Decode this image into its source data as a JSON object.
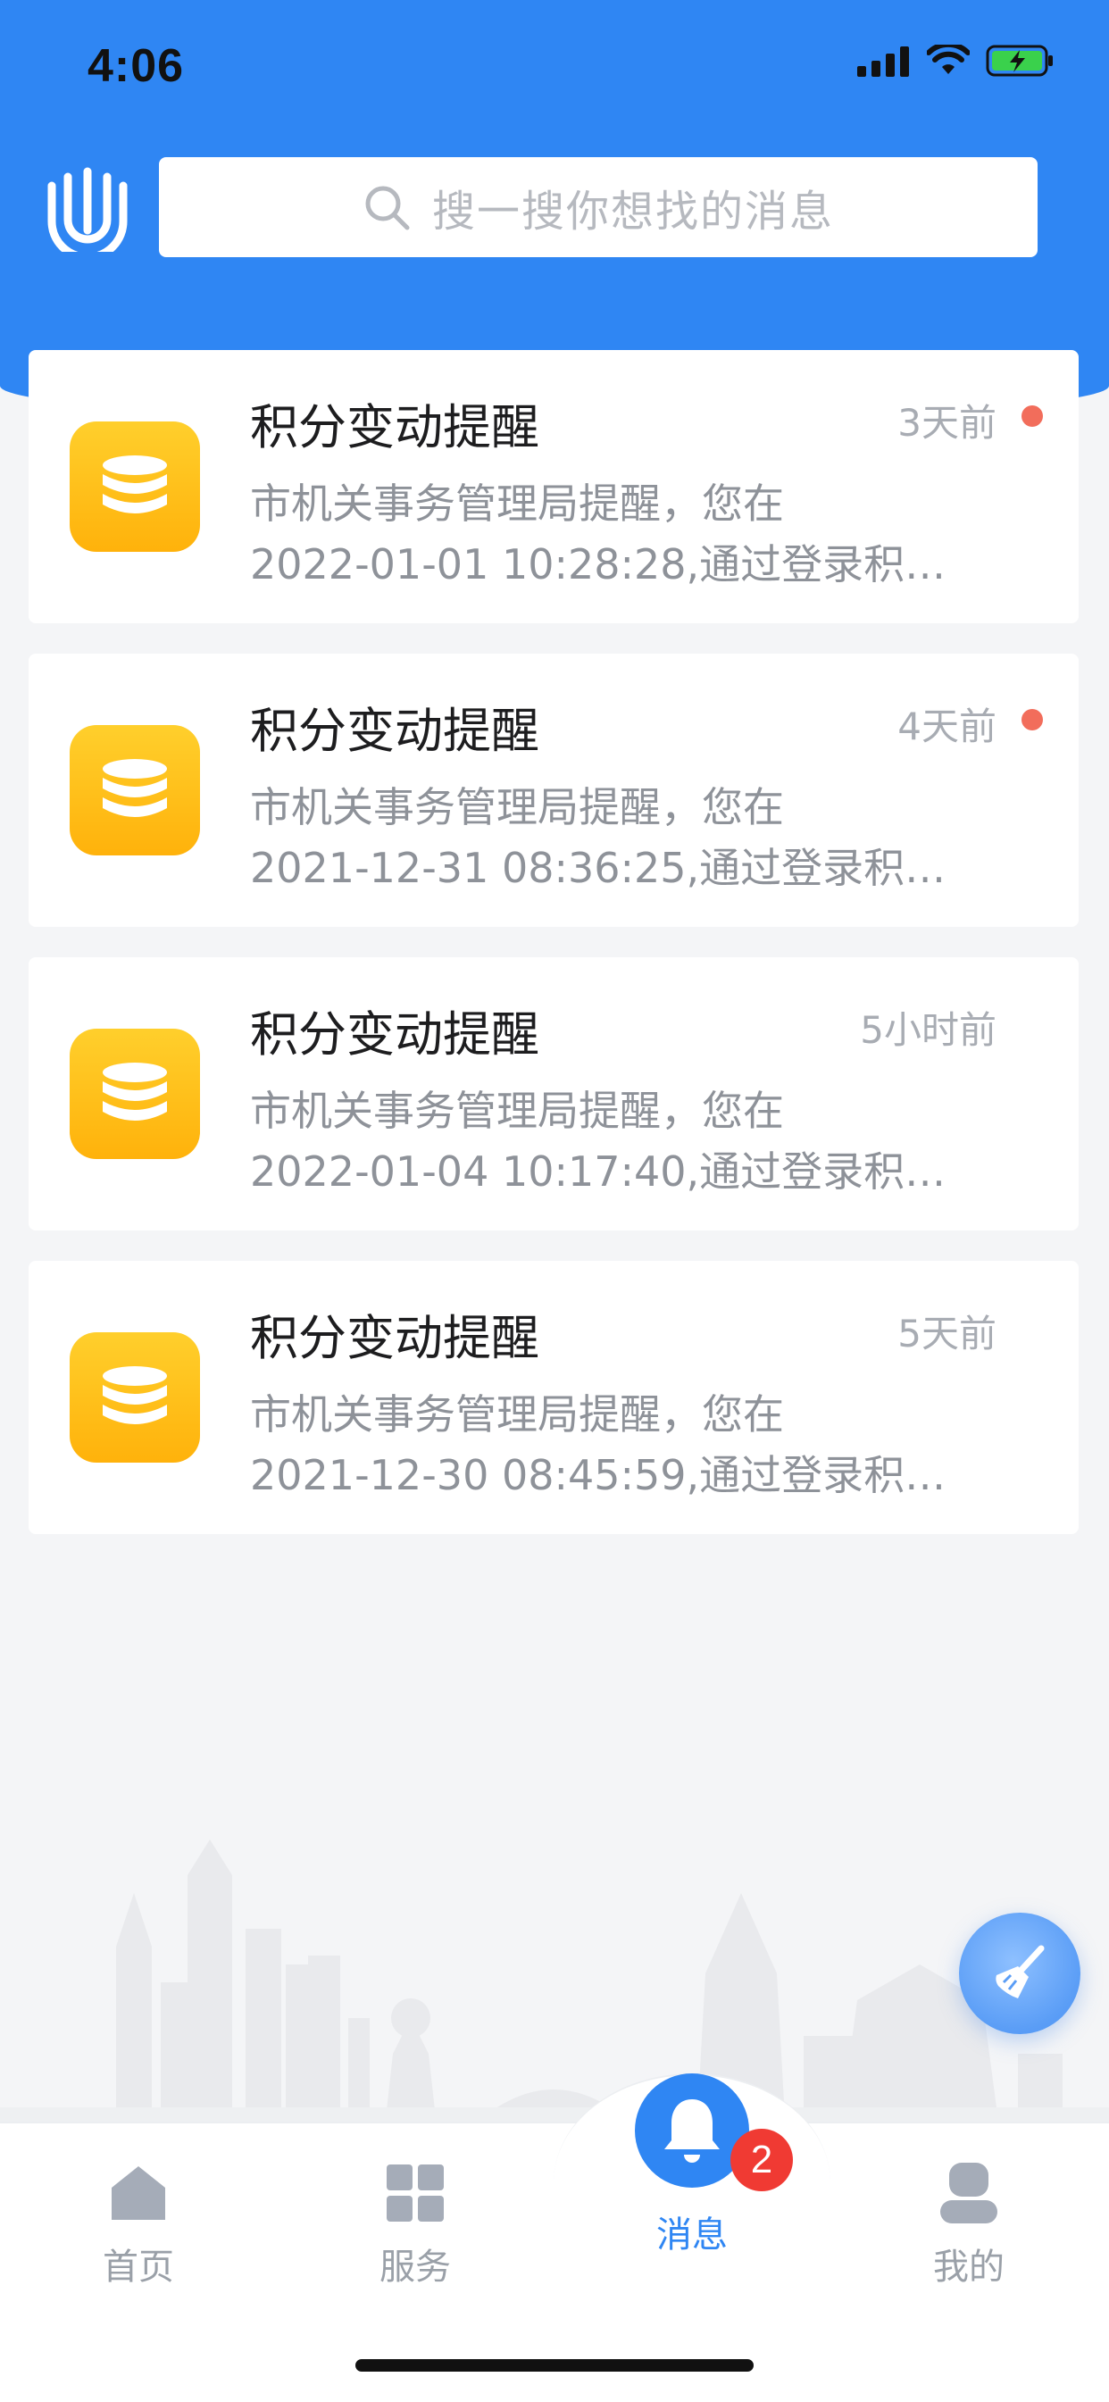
{
  "status_bar": {
    "time": "4:06"
  },
  "search": {
    "placeholder": "搜一搜你想找的消息"
  },
  "colors": {
    "brand": "#2f86f3",
    "icon_yellow": "#ffb20b",
    "unread": "#f26d5b",
    "badge": "#f03a33"
  },
  "messages": [
    {
      "title": "积分变动提醒",
      "time": "3天前",
      "unread": true,
      "line1": "市机关事务管理局提醒，您在",
      "line2": "2022-01-01 10:28:28,通过登录积…",
      "icon": "coin-stack-icon"
    },
    {
      "title": "积分变动提醒",
      "time": "4天前",
      "unread": true,
      "line1": "市机关事务管理局提醒，您在",
      "line2": "2021-12-31 08:36:25,通过登录积…",
      "icon": "coin-stack-icon"
    },
    {
      "title": "积分变动提醒",
      "time": "5小时前",
      "unread": false,
      "line1": "市机关事务管理局提醒，您在",
      "line2": "2022-01-04 10:17:40,通过登录积…",
      "icon": "coin-stack-icon"
    },
    {
      "title": "积分变动提醒",
      "time": "5天前",
      "unread": false,
      "line1": "市机关事务管理局提醒，您在",
      "line2": "2021-12-30 08:45:59,通过登录积…",
      "icon": "coin-stack-icon"
    }
  ],
  "tabbar": {
    "home": "首页",
    "services": "服务",
    "messages": "消息",
    "mine": "我的",
    "messages_badge": "2",
    "active": "messages"
  }
}
